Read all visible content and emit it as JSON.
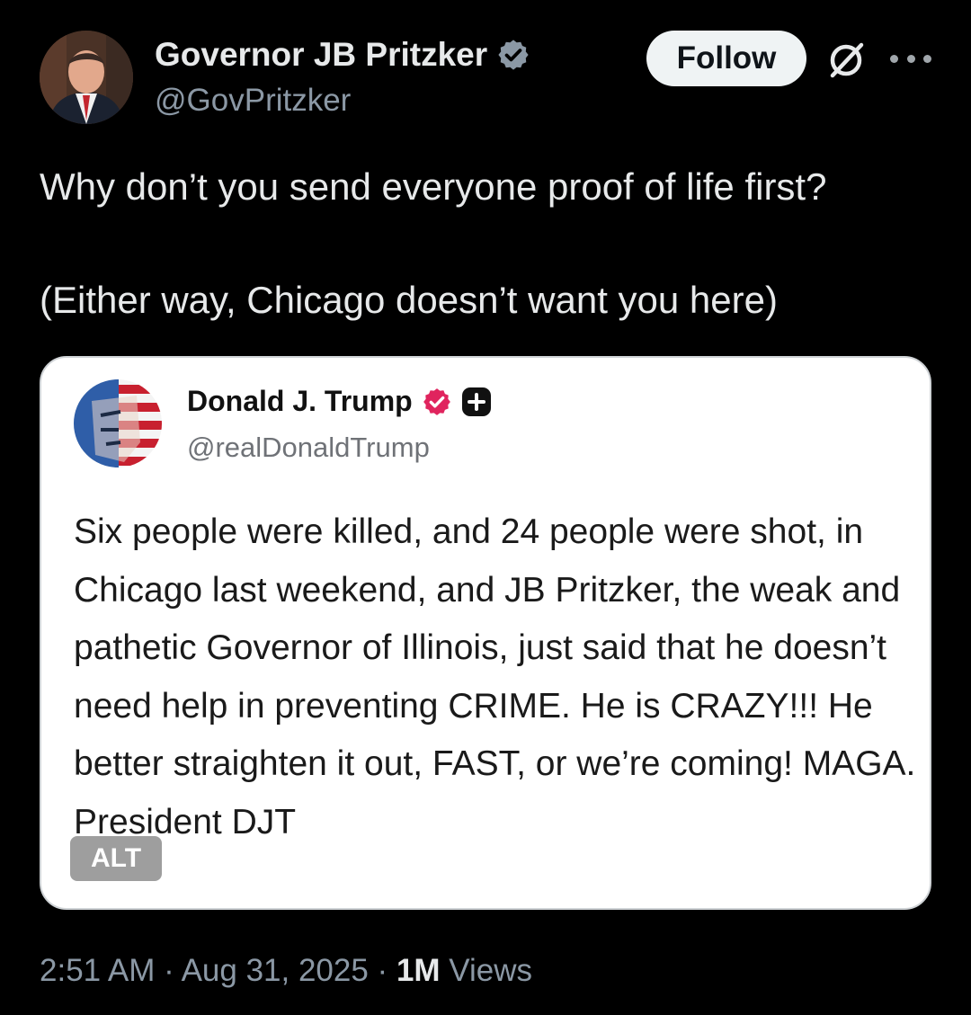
{
  "author": {
    "name": "Governor JB Pritzker",
    "handle": "@GovPritzker"
  },
  "follow_label": "Follow",
  "tweet": {
    "line1": "Why don’t you send everyone proof of life first?",
    "line2": "(Either way, Chicago doesn’t want you here)"
  },
  "quoted": {
    "name": "Donald J. Trump",
    "handle": "@realDonaldTrump",
    "text": "Six people were killed, and 24 people were shot, in Chicago last weekend, and JB Pritzker, the weak and pathetic Governor of Illinois, just said that he doesn’t need help in preventing CRIME. He is CRAZY!!! He better straighten it out, FAST, or we’re coming! MAGA. President DJT",
    "alt_label": "ALT"
  },
  "meta": {
    "timestamp": "2:51 AM · Aug 31, 2025 · ",
    "views_count": "1M",
    "views_label": " Views"
  },
  "icons": {
    "verified_color": "#1d9bf0",
    "quoted_badge_color": "#e0245e",
    "grok": "grok-icon",
    "more": "more-icon"
  }
}
